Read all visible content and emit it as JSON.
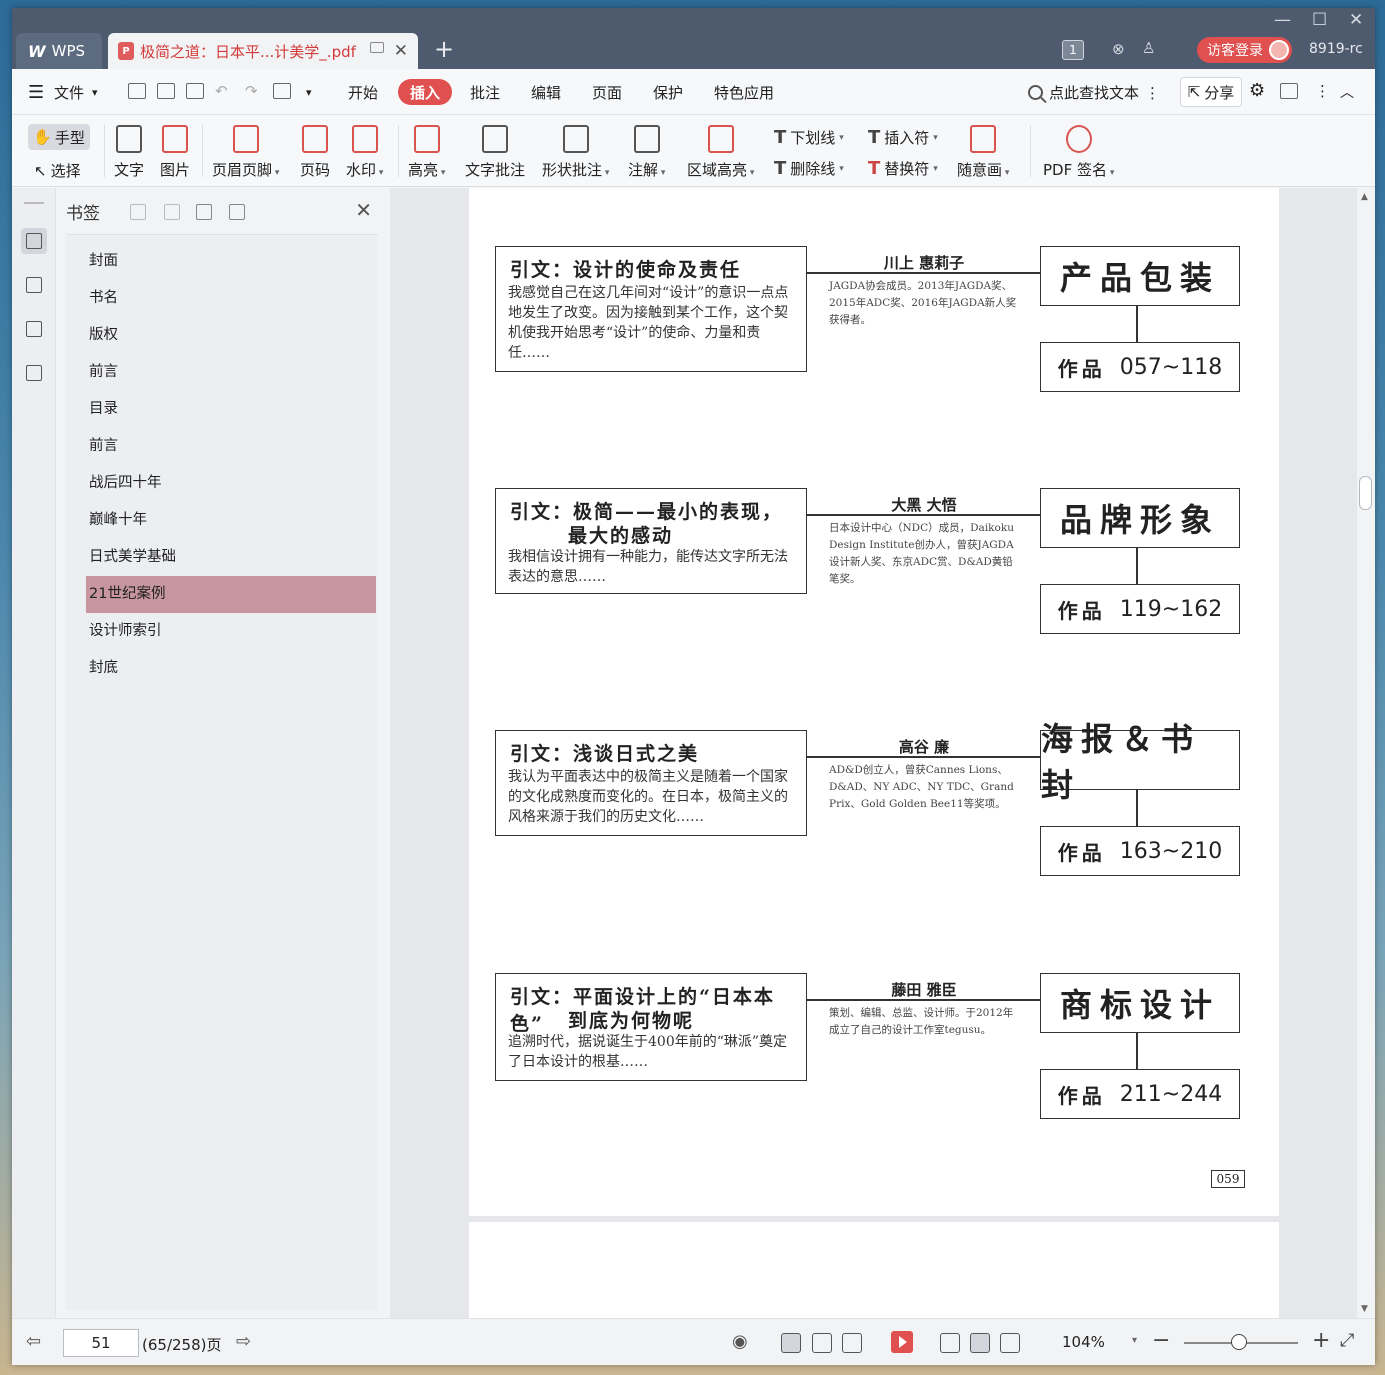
{
  "titlebar": {
    "app_tab": "WPS",
    "doc_tab": "极简之道：日本平...计美学_.pdf",
    "tab_count_badge": "1",
    "login_label": "访客登录",
    "user_id": "8919-rc"
  },
  "menubar": {
    "file_label": "文件",
    "items": [
      "开始",
      "插入",
      "批注",
      "编辑",
      "页面",
      "保护",
      "特色应用"
    ],
    "search_label": "点此查找文本",
    "share_label": "分享"
  },
  "ribbon": {
    "hand_label": "手型",
    "select_label": "选择",
    "text_label": "文字",
    "image_label": "图片",
    "header_footer_label": "页眉页脚",
    "page_number_label": "页码",
    "watermark_label": "水印",
    "highlight_label": "高亮",
    "text_comment_label": "文字批注",
    "shape_comment_label": "形状批注",
    "annotation_label": "注解",
    "area_highlight_label": "区域高亮",
    "underline_label": "下划线",
    "strikethrough_label": "删除线",
    "insert_mark_label": "插入符",
    "replace_mark_label": "替换符",
    "freehand_label": "随意画",
    "pdf_sign_label": "PDF 签名"
  },
  "bookmarks": {
    "title": "书签",
    "items": [
      "封面",
      "书名",
      "版权",
      "前言",
      "目录",
      "前言",
      "战后四十年",
      "巅峰十年",
      "日式美学基础",
      "21世纪案例",
      "设计师索引",
      "封底"
    ],
    "selected": "21世纪案例"
  },
  "page": {
    "sections": [
      {
        "intro_title": "引文：设计的使命及责任",
        "intro_title2": "",
        "intro_body": "我感觉自己在这几年间对“设计”的意识一点点地发生了改变。因为接触到某个工作，这个契机使我开始思考“设计”的使命、力量和责任……",
        "designer": "川上 惠莉子",
        "designer_desc": "JAGDA协会成员。2013年JAGDA奖、2015年ADC奖、2016年JAGDA新人奖获得者。",
        "category": "产品包装",
        "works_label": "作品",
        "works_range": "057~118"
      },
      {
        "intro_title": "引文：极简——最小的表现，",
        "intro_title2": "最大的感动",
        "intro_body": "我相信设计拥有一种能力，能传达文字所无法表达的意思……",
        "designer": "大黑 大悟",
        "designer_desc": "日本设计中心（NDC）成员，Daikoku Design Institute创办人，曾获JAGDA设计新人奖、东京ADC赏、D&AD黄铅笔奖。",
        "category": "品牌形象",
        "works_label": "作品",
        "works_range": "119~162"
      },
      {
        "intro_title": "引文：浅谈日式之美",
        "intro_title2": "",
        "intro_body": "我认为平面表达中的极简主义是随着一个国家的文化成熟度而变化的。在日本，极简主义的风格来源于我们的历史文化……",
        "designer": "高谷 廉",
        "designer_desc": "AD&D创立人，曾获Cannes Lions、D&AD、NY ADC、NY TDC、Grand Prix、Gold Golden Bee11等奖项。",
        "category": "海报＆书封",
        "works_label": "作品",
        "works_range": "163~210"
      },
      {
        "intro_title": "引文：平面设计上的“日本本色”",
        "intro_title2": "到底为何物呢",
        "intro_body": "追溯时代，据说诞生于400年前的“琳派”奠定了日本设计的根基……",
        "designer": "藤田 雅臣",
        "designer_desc": "策划、编辑、总监、设计师。于2012年成立了自己的设计工作室tegusu。",
        "category": "商标设计",
        "works_label": "作品",
        "works_range": "211~244"
      }
    ],
    "page_number": "059"
  },
  "statusbar": {
    "current_page": "51",
    "total_pages": "(65/258)页",
    "zoom": "104%"
  },
  "colors": {
    "accent": "#e0504f",
    "selected_bookmark": "#c8969e",
    "titlebar": "#4e5b6e"
  }
}
